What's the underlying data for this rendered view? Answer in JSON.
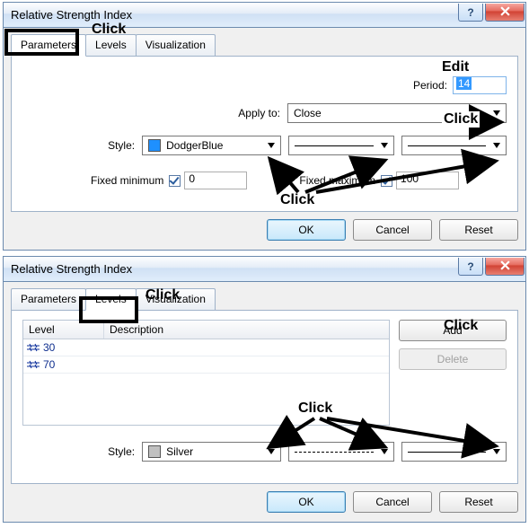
{
  "dialog1": {
    "title": "Relative Strength Index",
    "tabs": {
      "parameters": "Parameters",
      "levels": "Levels",
      "visualization": "Visualization"
    },
    "period_label": "Period:",
    "period_value": "14",
    "apply_to_label": "Apply to:",
    "apply_to_value": "Close",
    "style_label": "Style:",
    "style_color_name": "DodgerBlue",
    "style_color_hex": "#1E90FF",
    "fixed_min_label": "Fixed minimum",
    "fixed_min_value": "0",
    "fixed_max_label": "Fixed maximum",
    "fixed_max_value": "100",
    "buttons": {
      "ok": "OK",
      "cancel": "Cancel",
      "reset": "Reset"
    }
  },
  "dialog2": {
    "title": "Relative Strength Index",
    "tabs": {
      "parameters": "Parameters",
      "levels": "Levels",
      "visualization": "Visualization"
    },
    "table": {
      "col_level": "Level",
      "col_desc": "Description",
      "rows": [
        {
          "level": "30",
          "desc": ""
        },
        {
          "level": "70",
          "desc": ""
        }
      ]
    },
    "add_btn": "Add",
    "delete_btn": "Delete",
    "style_label": "Style:",
    "style_color_name": "Silver",
    "style_color_hex": "#C0C0C0",
    "buttons": {
      "ok": "OK",
      "cancel": "Cancel",
      "reset": "Reset"
    }
  },
  "annotations": {
    "click": "Click",
    "edit": "Edit"
  }
}
